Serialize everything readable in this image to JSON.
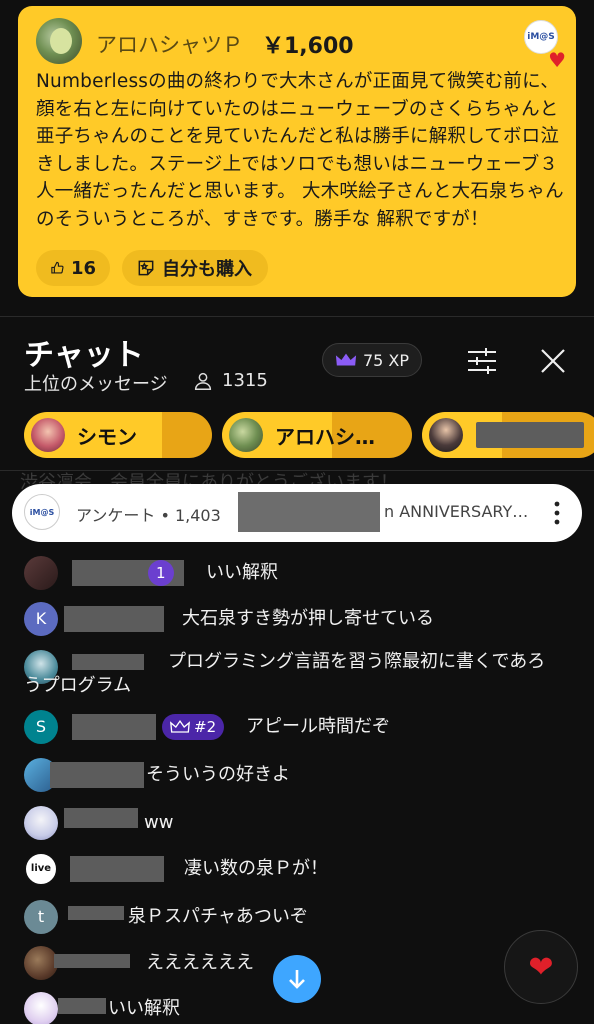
{
  "super_chat": {
    "author": "アロハシャツＰ",
    "amount": "￥1,600",
    "badge_logo": "iM@S",
    "message": "Numberlessの曲の終わりで大木さんが正面見て微笑む前に、顔を右と左に向けていたのはニューウェーブのさくらちゃんと亜子ちゃんのことを見ていたんだと私は勝手に解釈してボロ泣きしました。ステージ上ではソロでも想いはニューウェーブ３人一緒だったんだと思います。 大木咲絵子さんと大石泉ちゃんのそういうところが、すきです。勝手な 解釈ですが！",
    "likes": "16",
    "buy_label": "自分も購入"
  },
  "chat": {
    "title": "チャット",
    "mode": "上位のメッセージ",
    "viewers": "1315",
    "xp": "75 XP"
  },
  "ticker": [
    {
      "label": "シモン"
    },
    {
      "label": "アロハシ…"
    },
    {
      "label": ""
    }
  ],
  "ghost_line": "渋谷凛会　会員全員にありがとうございます！",
  "poll": {
    "logo": "iM@S",
    "text_start": "アンケート • 1,403",
    "text_end": "n ANNIVERSARY…"
  },
  "messages": [
    {
      "text": "いい解釈",
      "badge": "1"
    },
    {
      "avatar_letter": "K",
      "text": "大石泉すき勢が押し寄せている"
    },
    {
      "text": "プログラミング言語を習う際最初に書くであろうプログラム"
    },
    {
      "avatar_letter": "S",
      "text": "アピール時間だぞ",
      "badge": "#2"
    },
    {
      "text": "そういうの好きよ"
    },
    {
      "text": "ww"
    },
    {
      "avatar_letter": "live",
      "text": "凄い数の泉Ｐが！"
    },
    {
      "avatar_letter": "t",
      "text": "泉Ｐスパチャあついぞ"
    },
    {
      "text": "ええええええ"
    },
    {
      "text": "いい解釈"
    }
  ],
  "colors": {
    "super_chat": "#ffca28",
    "accent_blue": "#3ea6ff",
    "member_badge": "#6b3fcf",
    "background": "#0f0f0f"
  }
}
